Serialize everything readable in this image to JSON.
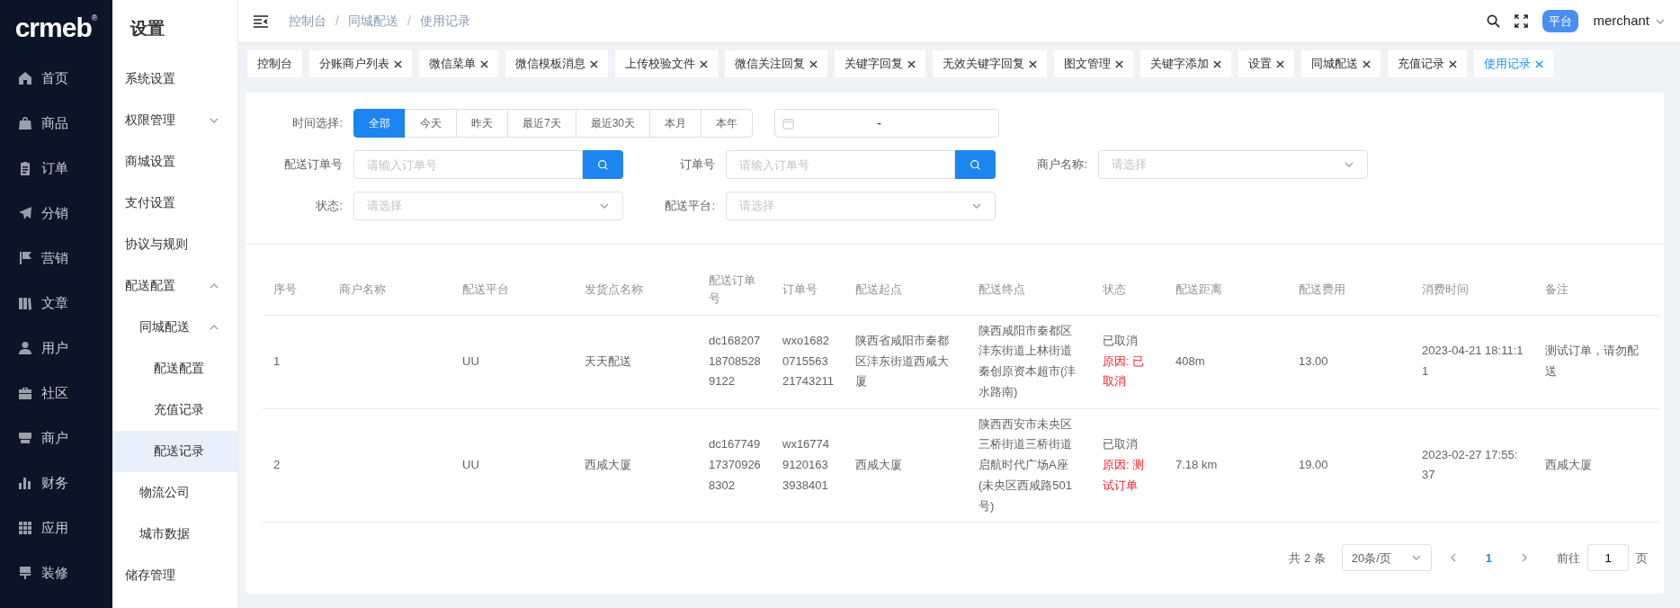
{
  "nav": {
    "logo": "crmeb",
    "registered": "®",
    "items": [
      {
        "label": "首页"
      },
      {
        "label": "商品"
      },
      {
        "label": "订单"
      },
      {
        "label": "分销"
      },
      {
        "label": "营销"
      },
      {
        "label": "文章"
      },
      {
        "label": "用户"
      },
      {
        "label": "社区"
      },
      {
        "label": "商户"
      },
      {
        "label": "财务"
      },
      {
        "label": "应用"
      },
      {
        "label": "装修"
      }
    ]
  },
  "submenu": {
    "title": "设置",
    "items": [
      {
        "label": "系统设置",
        "selected": false
      },
      {
        "label": "权限管理",
        "selected": false,
        "expanded": false
      },
      {
        "label": "商城设置",
        "selected": false
      },
      {
        "label": "支付设置",
        "selected": false
      },
      {
        "label": "协议与规则",
        "selected": false
      },
      {
        "label": "配送配置",
        "selected": false,
        "expanded": true,
        "children": [
          {
            "label": "同城配送",
            "selected": false,
            "expanded": true,
            "children": [
              {
                "label": "配送配置",
                "selected": false
              },
              {
                "label": "充值记录",
                "selected": false
              },
              {
                "label": "配送记录",
                "selected": true
              }
            ]
          },
          {
            "label": "物流公司",
            "selected": false
          },
          {
            "label": "城市数据",
            "selected": false
          }
        ]
      },
      {
        "label": "储存管理",
        "selected": false
      }
    ]
  },
  "header": {
    "breadcrumb": [
      "控制台",
      "同城配送",
      "使用记录"
    ],
    "breadcrumb_separator": "/",
    "badge": "平台",
    "user": "merchant"
  },
  "tabs": [
    {
      "label": "控制台",
      "selected": false,
      "closable": false
    },
    {
      "label": "分账商户列表",
      "selected": false,
      "closable": true
    },
    {
      "label": "微信菜单",
      "selected": false,
      "closable": true
    },
    {
      "label": "微信模板消息",
      "selected": false,
      "closable": true
    },
    {
      "label": "上传校验文件",
      "selected": false,
      "closable": true
    },
    {
      "label": "微信关注回复",
      "selected": false,
      "closable": true
    },
    {
      "label": "关键字回复",
      "selected": false,
      "closable": true
    },
    {
      "label": "无效关键字回复",
      "selected": false,
      "closable": true
    },
    {
      "label": "图文管理",
      "selected": false,
      "closable": true
    },
    {
      "label": "关键字添加",
      "selected": false,
      "closable": true
    },
    {
      "label": "设置",
      "selected": false,
      "closable": true
    },
    {
      "label": "同城配送",
      "selected": false,
      "closable": true
    },
    {
      "label": "充值记录",
      "selected": false,
      "closable": true
    },
    {
      "label": "使用记录",
      "selected": true,
      "closable": true
    }
  ],
  "filters": {
    "time_label": "时间选择:",
    "time_options": [
      {
        "label": "全部",
        "selected": true
      },
      {
        "label": "今天",
        "selected": false
      },
      {
        "label": "昨天",
        "selected": false
      },
      {
        "label": "最近7天",
        "selected": false
      },
      {
        "label": "最近30天",
        "selected": false
      },
      {
        "label": "本月",
        "selected": false
      },
      {
        "label": "本年",
        "selected": false
      }
    ],
    "date_range": {
      "separator": "-"
    },
    "fields": [
      {
        "kind": "search",
        "label": "配送订单号",
        "placeholder": "请输入订单号"
      },
      {
        "kind": "search",
        "label": "订单号",
        "placeholder": "请输入订单号"
      },
      {
        "kind": "select",
        "label": "商户名称:",
        "placeholder": "请选择"
      },
      {
        "kind": "select",
        "label": "状态:",
        "placeholder": "请选择"
      },
      {
        "kind": "select",
        "label": "配送平台:",
        "placeholder": "请选择"
      }
    ]
  },
  "table": {
    "columns": [
      "序号",
      "商户名称",
      "配送平台",
      "发货点名称",
      "配送订单号",
      "订单号",
      "配送起点",
      "配送终点",
      "状态",
      "配送距离",
      "配送费用",
      "消费时间",
      "备注"
    ],
    "rows": [
      {
        "index": "1",
        "platform": "UU",
        "sender": "天天配送",
        "delivery_no": "dc168207187085289122",
        "order_no": "wxo1682071556321743211",
        "origin": "陕西省咸阳市秦都区沣东街道西咸大厦",
        "destination": "陕西咸阳市秦都区沣东街道上林街道秦创原资本超市(沣水路南)",
        "status": "已取消",
        "reason": "原因: 已取消",
        "distance": "408m",
        "fee": "13.00",
        "time": "2023-04-21 18:11:11",
        "remark": "测试订单，请勿配送"
      },
      {
        "index": "2",
        "platform": "UU",
        "sender": "西咸大厦",
        "delivery_no": "dc167749173709268302",
        "order_no": "wx1677491201633938401",
        "origin": "西咸大厦",
        "destination": "陕西西安市未央区三桥街道三桥街道启航时代广场A座(未央区西咸路501号)",
        "status": "已取消",
        "reason": "原因: 测试订单",
        "distance": "7.18 km",
        "fee": "19.00",
        "time": "2023-02-27 17:55:37",
        "remark": "西咸大厦"
      }
    ]
  },
  "pagination": {
    "total": "共 2 条",
    "page_size": "20条/页",
    "pages": [
      {
        "label": "1",
        "selected": true
      }
    ],
    "goto_label": "前往",
    "goto_value": "1",
    "goto_suffix": "页"
  }
}
